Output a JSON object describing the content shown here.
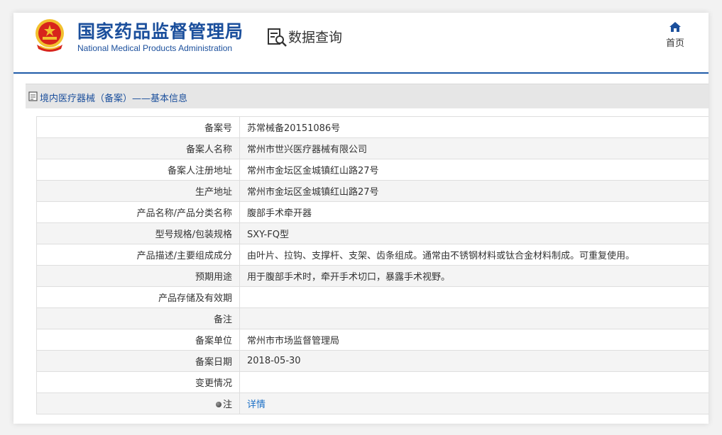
{
  "header": {
    "org_name_cn": "国家药品监督管理局",
    "org_name_en": "National Medical Products Administration",
    "query_title": "数据查询",
    "home_label": "首页"
  },
  "section": {
    "title": "境内医疗器械（备案）——基本信息"
  },
  "rows": [
    {
      "label": "备案号",
      "value": "苏常械备20151086号"
    },
    {
      "label": "备案人名称",
      "value": "常州市世兴医疗器械有限公司"
    },
    {
      "label": "备案人注册地址",
      "value": "常州市金坛区金城镇红山路27号"
    },
    {
      "label": "生产地址",
      "value": "常州市金坛区金城镇红山路27号"
    },
    {
      "label": "产品名称/产品分类名称",
      "value": "腹部手术牵开器"
    },
    {
      "label": "型号规格/包装规格",
      "value": "SXY-FQ型"
    },
    {
      "label": "产品描述/主要组成成分",
      "value": "由叶片、拉钩、支撑杆、支架、齿条组成。通常由不锈钢材料或钛合金材料制成。可重复使用。"
    },
    {
      "label": "预期用途",
      "value": "用于腹部手术时，牵开手术切口，暴露手术视野。"
    },
    {
      "label": "产品存储及有效期",
      "value": ""
    },
    {
      "label": "备注",
      "value": ""
    },
    {
      "label": "备案单位",
      "value": "常州市市场监督管理局"
    },
    {
      "label": "备案日期",
      "value": "2018-05-30"
    },
    {
      "label": "变更情况",
      "value": ""
    }
  ],
  "note_row": {
    "label": "注",
    "link_text": "详情"
  },
  "colors": {
    "brand_blue": "#1b4f9c",
    "link_blue": "#1b6fc6",
    "emblem_red": "#d7251c",
    "emblem_gold": "#f2c12e"
  }
}
